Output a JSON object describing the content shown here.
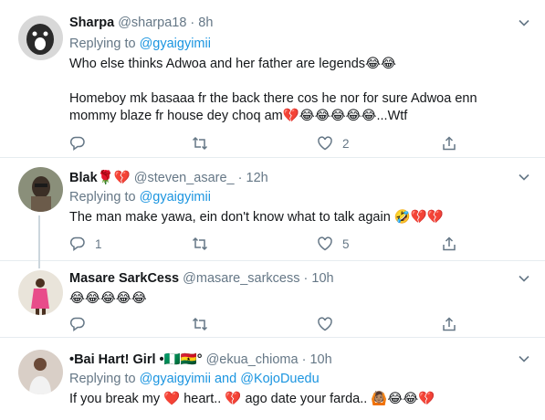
{
  "tweets": [
    {
      "name": "Sharpa",
      "handle": "@sharpa18",
      "time": "8h",
      "reply_prefix": "Replying to ",
      "reply_to": "@gyaigyimii",
      "reply_conj": "",
      "reply_to2": "",
      "line1": "Who else thinks Adwoa and her father are legends😂😂",
      "line2": "",
      "line3": "Homeboy mk basaaa fr the back there cos he nor for sure Adwoa enn",
      "line4": "mommy blaze fr house dey choq am💔😂😂😂😂😂...Wtf",
      "replies": "",
      "likes": "2"
    },
    {
      "name": "Blak🌹💔",
      "handle": "@steven_asare_",
      "time": "12h",
      "reply_prefix": "Replying to ",
      "reply_to": "@gyaigyimii",
      "reply_conj": "",
      "reply_to2": "",
      "line1": "The man make yawa, ein don't know what to talk again 🤣💔💔",
      "replies": "1",
      "likes": "5"
    },
    {
      "name": "Masare SarkCess",
      "handle": "@masare_sarkcess",
      "time": "10h",
      "line1": "😂😂😂😂😂",
      "replies": "",
      "likes": ""
    },
    {
      "name": "•Bai Hart! Girl •🇳🇬🇬🇭°",
      "handle": "@ekua_chioma",
      "time": "10h",
      "reply_prefix": "Replying to ",
      "reply_to": "@gyaigyimii",
      "reply_conj": " and ",
      "reply_to2": "@KojoDuedu",
      "line1": "If you break my ❤️ heart.. 💔 ago date your farda.. 🙆🏽😂😂💔"
    }
  ],
  "separator_dot": "·",
  "icons": {
    "reply": "reply-icon",
    "retweet": "retweet-icon",
    "like": "heart-icon",
    "share": "share-icon",
    "menu": "chevron-down-icon"
  },
  "colors": {
    "link": "#1b95e0",
    "muted": "#657786",
    "text": "#14171a",
    "border": "#e6ecf0"
  }
}
